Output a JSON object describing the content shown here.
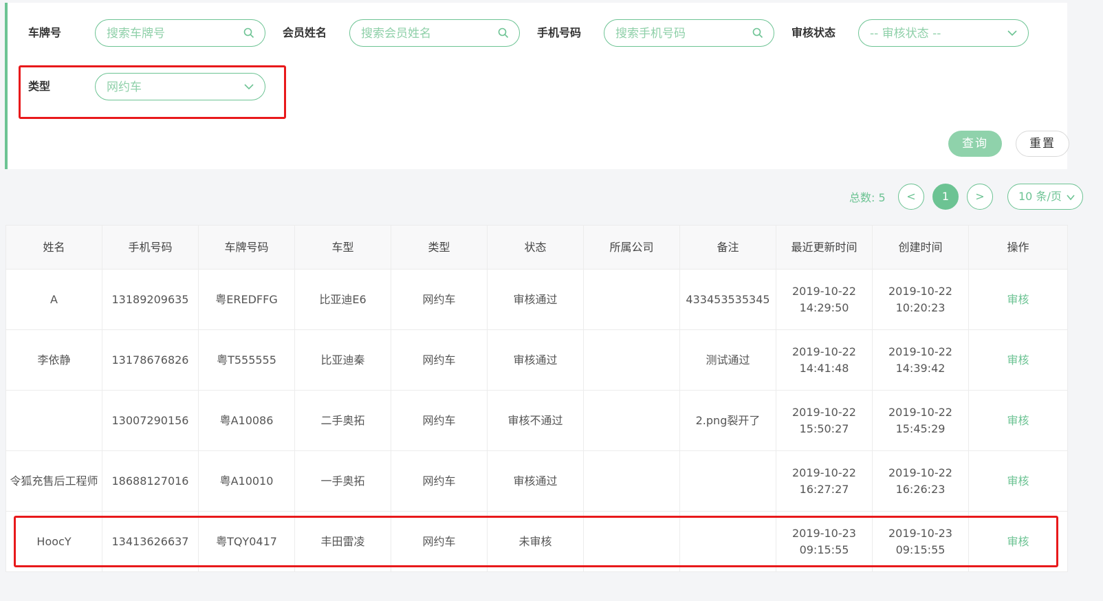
{
  "filters": {
    "plate_label": "车牌号",
    "plate_placeholder": "搜索车牌号",
    "member_label": "会员姓名",
    "member_placeholder": "搜索会员姓名",
    "phone_label": "手机号码",
    "phone_placeholder": "搜索手机号码",
    "status_label": "审核状态",
    "status_value": "-- 审核状态 --",
    "type_label": "类型",
    "type_value": "网约车"
  },
  "buttons": {
    "query": "查询",
    "reset": "重置"
  },
  "pager": {
    "total_label": "总数:",
    "total": "5",
    "prev": "<",
    "current": "1",
    "next": ">",
    "page_size": "10 条/页"
  },
  "table": {
    "headers": [
      "姓名",
      "手机号码",
      "车牌号码",
      "车型",
      "类型",
      "状态",
      "所属公司",
      "备注",
      "最近更新时间",
      "创建时间",
      "操作"
    ],
    "rows": [
      {
        "name": "A",
        "phone": "13189209635",
        "plate": "粤EREDFFG",
        "model": "比亚迪E6",
        "type": "网约车",
        "status": "审核通过",
        "company": "",
        "remark": "433453535345",
        "updated_date": "2019-10-22",
        "updated_time": "14:29:50",
        "created_date": "2019-10-22",
        "created_time": "10:20:23",
        "action": "审核"
      },
      {
        "name": "李依静",
        "phone": "13178676826",
        "plate": "粤T555555",
        "model": "比亚迪秦",
        "type": "网约车",
        "status": "审核通过",
        "company": "",
        "remark": "测试通过",
        "updated_date": "2019-10-22",
        "updated_time": "14:41:48",
        "created_date": "2019-10-22",
        "created_time": "14:39:42",
        "action": "审核"
      },
      {
        "name": "",
        "phone": "13007290156",
        "plate": "粤A10086",
        "model": "二手奥拓",
        "type": "网约车",
        "status": "审核不通过",
        "company": "",
        "remark": "2.png裂开了",
        "updated_date": "2019-10-22",
        "updated_time": "15:50:27",
        "created_date": "2019-10-22",
        "created_time": "15:45:29",
        "action": "审核"
      },
      {
        "name": "令狐充售后工程师",
        "phone": "18688127016",
        "plate": "粤A10010",
        "model": "一手奥拓",
        "type": "网约车",
        "status": "审核通过",
        "company": "",
        "remark": "",
        "updated_date": "2019-10-22",
        "updated_time": "16:27:27",
        "created_date": "2019-10-22",
        "created_time": "16:26:23",
        "action": "审核"
      },
      {
        "name": "HoocY",
        "phone": "13413626637",
        "plate": "粤TQY0417",
        "model": "丰田雷凌",
        "type": "网约车",
        "status": "未审核",
        "company": "",
        "remark": "",
        "updated_date": "2019-10-23",
        "updated_time": "09:15:55",
        "created_date": "2019-10-23",
        "created_time": "09:15:55",
        "action": "审核"
      }
    ]
  },
  "colors": {
    "accent": "#6cc393",
    "accent_light": "#8fd2ab",
    "highlight": "#e8191b"
  }
}
